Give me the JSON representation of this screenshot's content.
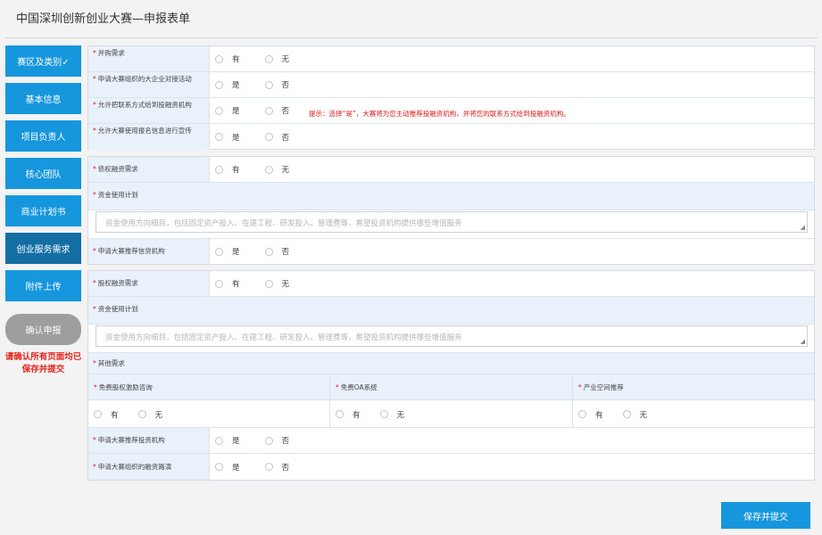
{
  "page": {
    "title": "中国深圳创新创业大赛—申报表单"
  },
  "nav": [
    {
      "label": "赛区及类别✓"
    },
    {
      "label": "基本信息"
    },
    {
      "label": "项目负责人"
    },
    {
      "label": "核心团队"
    },
    {
      "label": "商业计划书"
    },
    {
      "label": "创业服务需求"
    },
    {
      "label": "附件上传"
    }
  ],
  "confirm": {
    "label": "确认申报",
    "notice": "请确认所有页面均已保存并提交"
  },
  "required_mark": "*",
  "section1": {
    "rows": [
      {
        "label": "并购需求",
        "options": [
          "有",
          "无"
        ]
      },
      {
        "label": "申请大赛组织的大企业对接活动",
        "options": [
          "是",
          "否"
        ]
      },
      {
        "label": "允许把联系方式给到投融资机构",
        "options": [
          "是",
          "否"
        ],
        "hint": "提示：选择“是”，大赛将为您主动推荐投融资机构，并将您的联系方式给到投融资机构。"
      },
      {
        "label": "允许大赛使用报名信息进行宣传",
        "options": [
          "是",
          "否"
        ]
      }
    ]
  },
  "section2": {
    "demand": {
      "label": "债权融资需求",
      "options": [
        "有",
        "无"
      ]
    },
    "plan": {
      "label": "资金使用计划",
      "placeholder": "资金使用方向细目，包括固定资产投入、在建工程、研发投入、管理费等，希望投资机构提供哪些增值服务"
    },
    "recommend": {
      "label": "申请大赛推荐信贷机构",
      "options": [
        "是",
        "否"
      ]
    }
  },
  "section3": {
    "demand": {
      "label": "股权融资需求",
      "options": [
        "有",
        "无"
      ]
    },
    "plan": {
      "label": "资金使用计划",
      "placeholder": "资金使用方向细目，包括固定资产投入、在建工程、研发投入、管理费等，希望投资机构提供哪些增值服务"
    },
    "other": {
      "label": "其他需求"
    },
    "columns": [
      {
        "label": "免费股权激励咨询",
        "options": [
          "有",
          "无"
        ]
      },
      {
        "label": "免费OA系统",
        "options": [
          "有",
          "无"
        ]
      },
      {
        "label": "产业空间推荐",
        "options": [
          "有",
          "无"
        ]
      }
    ],
    "rows": [
      {
        "label": "申请大赛推荐投资机构",
        "options": [
          "是",
          "否"
        ]
      },
      {
        "label": "申请大赛组织的融资路演",
        "options": [
          "是",
          "否"
        ]
      }
    ]
  },
  "submit": {
    "label": "保存并提交"
  }
}
